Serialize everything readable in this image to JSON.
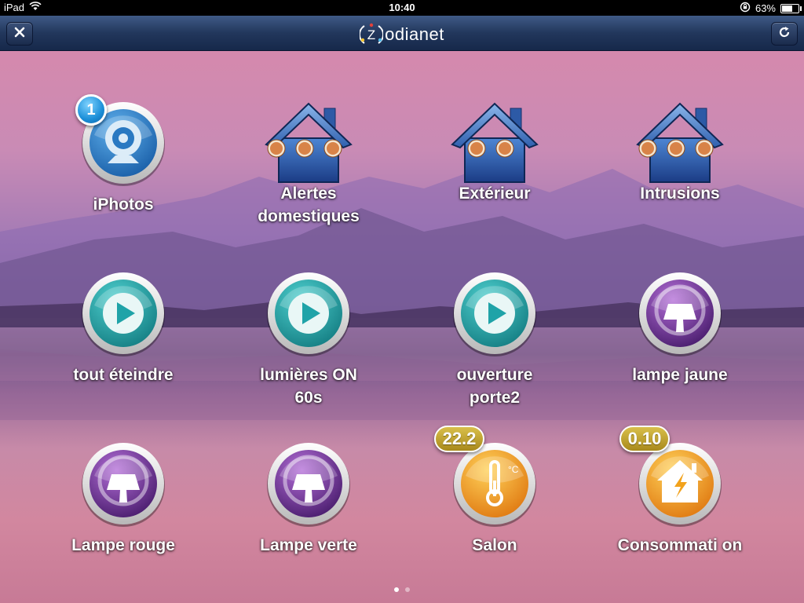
{
  "status_bar": {
    "device": "iPad",
    "time": "10:40",
    "battery_text": "63%",
    "battery_level": 0.63
  },
  "nav": {
    "close_icon": "close-icon",
    "refresh_icon": "refresh-icon",
    "logo_letter": "Z",
    "logo_text": "odianet"
  },
  "tiles": [
    {
      "label": "iPhotos",
      "icon": "webcam-icon",
      "badge": "1"
    },
    {
      "label": "Alertes domestiques",
      "icon": "house-alerts-icon"
    },
    {
      "label": "Extérieur",
      "icon": "house-exterior-icon"
    },
    {
      "label": "Intrusions",
      "icon": "house-intrusion-icon"
    },
    {
      "label": "tout éteindre",
      "icon": "play-icon"
    },
    {
      "label": "lumières ON 60s",
      "icon": "play-icon"
    },
    {
      "label": "ouverture porte2",
      "icon": "play-icon"
    },
    {
      "label": "lampe jaune",
      "icon": "lamp-icon"
    },
    {
      "label": "Lampe rouge",
      "icon": "lamp-icon"
    },
    {
      "label": "Lampe verte",
      "icon": "lamp-icon"
    },
    {
      "label": "Salon",
      "icon": "thermometer-icon",
      "value": "22.2",
      "unit": "°C"
    },
    {
      "label": "Consommati on",
      "icon": "house-power-icon",
      "value": "0.10"
    }
  ],
  "page_dots": {
    "count": 2,
    "current": 1
  },
  "colors": {
    "nav": "#22375c",
    "teal": "#1fa3a8",
    "purple": "#6b2f8c",
    "orange": "#f2a21c",
    "blue": "#2b6cc0"
  }
}
